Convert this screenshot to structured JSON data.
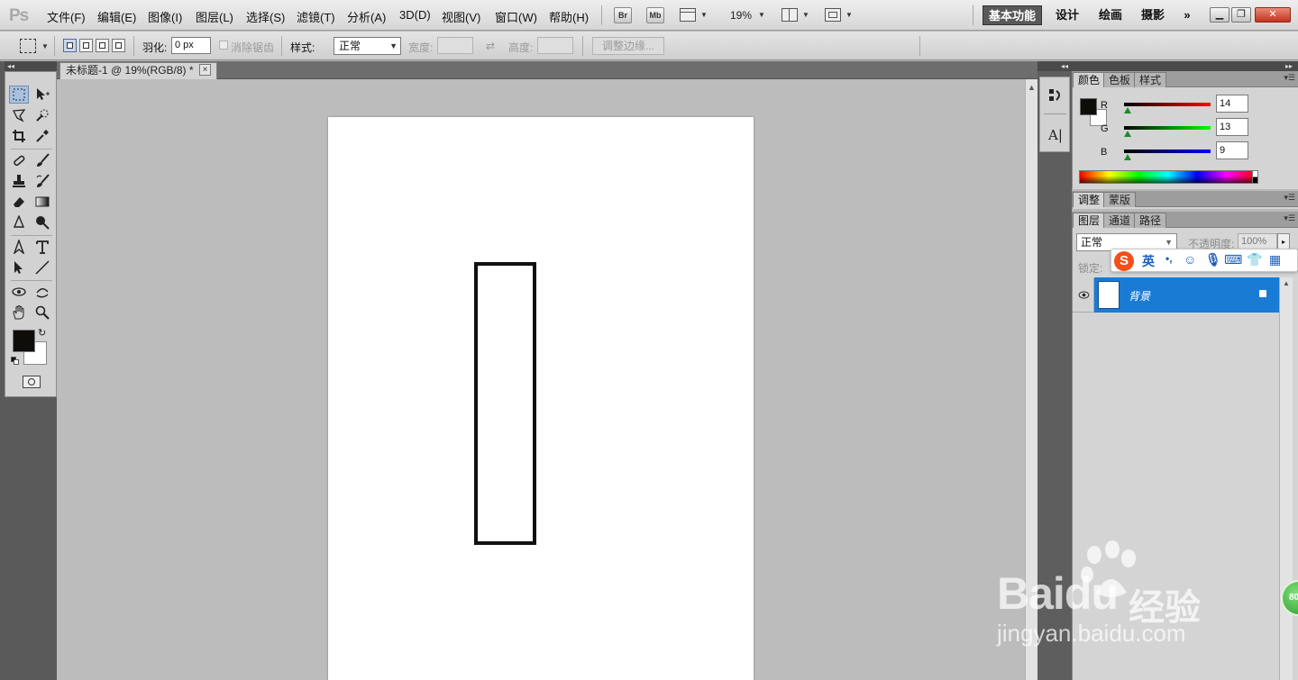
{
  "app": {
    "logo": "Ps"
  },
  "menu": [
    "文件(F)",
    "编辑(E)",
    "图像(I)",
    "图层(L)",
    "选择(S)",
    "滤镜(T)",
    "分析(A)",
    "3D(D)",
    "视图(V)",
    "窗口(W)",
    "帮助(H)"
  ],
  "menubar": {
    "bridge_label": "Br",
    "minibridge_label": "Mb",
    "zoom": "19%",
    "workspaces": [
      "基本功能",
      "设计",
      "绘画",
      "摄影"
    ],
    "more_label": "»"
  },
  "options": {
    "feather_label": "羽化:",
    "feather_value": "0 px",
    "antialias_label": "消除锯齿",
    "style_label": "样式:",
    "style_value": "正常",
    "width_label": "宽度:",
    "height_label": "高度:",
    "refine_label": "调整边缘..."
  },
  "document": {
    "tab_title": "未标题-1 @ 19%(RGB/8) *",
    "close_label": "×"
  },
  "dock": {
    "icon_text_1": "A|"
  },
  "color_panel": {
    "tabs": [
      "颜色",
      "色板",
      "样式"
    ],
    "r_label": "R",
    "g_label": "G",
    "b_label": "B",
    "r": "14",
    "g": "13",
    "b": "9",
    "foreground_color": "#0e0d09",
    "background_color": "#ffffff"
  },
  "adjust_panel": {
    "tabs": [
      "调整",
      "蒙版"
    ]
  },
  "layers_panel": {
    "tabs": [
      "图层",
      "通道",
      "路径"
    ],
    "blend_mode": "正常",
    "opacity_label": "不透明度:",
    "opacity_value": "100%",
    "lock_label": "锁定:",
    "layer_name": "背景",
    "selected_color": "#1a7bd5"
  },
  "ime": {
    "logo": "S",
    "mode": "英",
    "punct": "•,"
  },
  "watermark": {
    "brand": "Bai",
    "brand2": "du",
    "cn": "经验",
    "url": "jingyan.baidu.com"
  },
  "badge": {
    "text": "80"
  }
}
